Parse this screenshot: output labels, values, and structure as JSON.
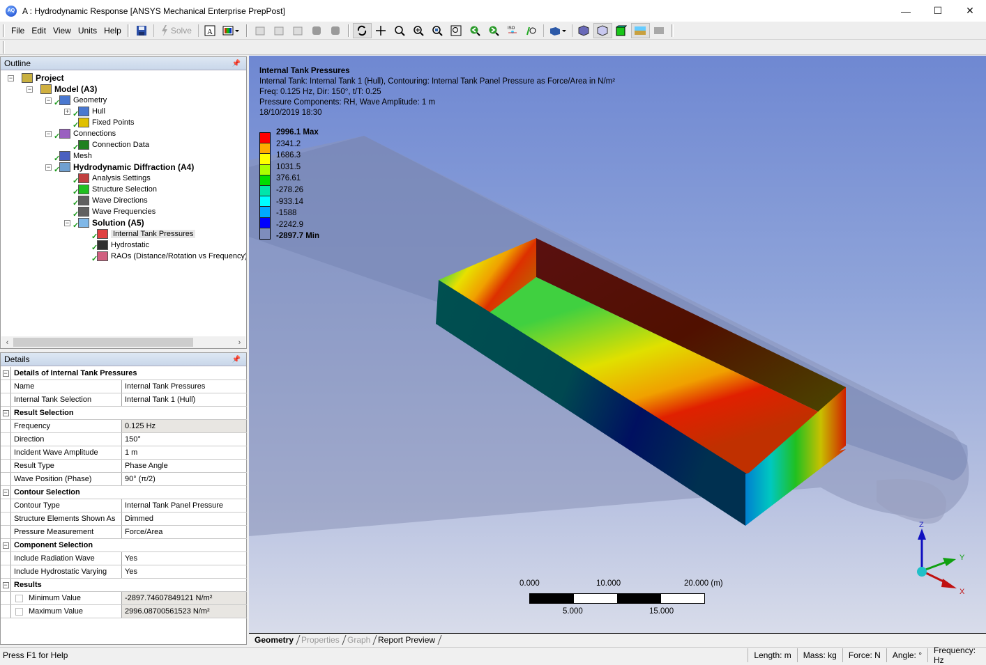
{
  "window": {
    "title": "A : Hydrodynamic Response [ANSYS Mechanical Enterprise PrepPost]",
    "app_icon_label": "AQ",
    "controls": {
      "minimize": "—",
      "maximize": "☐",
      "close": "✕"
    }
  },
  "menu": [
    "File",
    "Edit",
    "View",
    "Units",
    "Help"
  ],
  "toolbar": {
    "solve_label": "Solve",
    "icons": [
      "save-icon",
      "solve-icon",
      "annotation-icon",
      "display-style-icon",
      "select-point-icon",
      "select-face-icon",
      "select-body-icon",
      "select-face-filled-icon",
      "select-edge-icon",
      "rotate-icon",
      "pan-icon",
      "zoom-icon",
      "box-zoom-icon",
      "zoom-to-fit-icon",
      "zoom-region-icon",
      "previous-view-icon",
      "next-view-icon",
      "iso-view-icon",
      "look-at-icon",
      "view-box-icon",
      "wireframe-icon",
      "shaded-icon",
      "solid-green-icon",
      "water-surface-icon",
      "grey-box-icon"
    ]
  },
  "outline": {
    "title": "Outline",
    "nodes": [
      {
        "label": "Project",
        "bold": true,
        "level": 0,
        "icon": "project-icon",
        "check": false,
        "expander": "−"
      },
      {
        "label": "Model (A3)",
        "bold": true,
        "level": 1,
        "icon": "model-icon",
        "check": false,
        "expander": "−"
      },
      {
        "label": "Geometry",
        "bold": false,
        "level": 2,
        "icon": "geometry-icon",
        "check": true,
        "expander": "−"
      },
      {
        "label": "Hull",
        "bold": false,
        "level": 3,
        "icon": "body-icon",
        "check": true,
        "expander": "+"
      },
      {
        "label": "Fixed Points",
        "bold": false,
        "level": 3,
        "icon": "anchor-icon",
        "check": true,
        "expander": ""
      },
      {
        "label": "Connections",
        "bold": false,
        "level": 2,
        "icon": "connections-icon",
        "check": true,
        "expander": "−"
      },
      {
        "label": "Connection Data",
        "bold": false,
        "level": 3,
        "icon": "connection-data-icon",
        "check": true,
        "expander": ""
      },
      {
        "label": "Mesh",
        "bold": false,
        "level": 2,
        "icon": "mesh-icon",
        "check": true,
        "expander": ""
      },
      {
        "label": "Hydrodynamic Diffraction (A4)",
        "bold": true,
        "level": 2,
        "icon": "diffraction-icon",
        "check": true,
        "expander": "−"
      },
      {
        "label": "Analysis Settings",
        "bold": false,
        "level": 3,
        "icon": "analysis-settings-icon",
        "check": true,
        "expander": ""
      },
      {
        "label": "Structure Selection",
        "bold": false,
        "level": 3,
        "icon": "structure-selection-icon",
        "check": true,
        "expander": ""
      },
      {
        "label": "Wave Directions",
        "bold": false,
        "level": 3,
        "icon": "wave-directions-icon",
        "check": true,
        "expander": ""
      },
      {
        "label": "Wave Frequencies",
        "bold": false,
        "level": 3,
        "icon": "wave-frequencies-icon",
        "check": true,
        "expander": ""
      },
      {
        "label": "Solution (A5)",
        "bold": true,
        "level": 3,
        "icon": "solution-folder-icon",
        "check": true,
        "expander": "−"
      },
      {
        "label": "Internal Tank Pressures",
        "bold": false,
        "level": 4,
        "icon": "contour-result-icon",
        "check": true,
        "expander": "",
        "selected": true
      },
      {
        "label": "Hydrostatic",
        "bold": false,
        "level": 4,
        "icon": "table-icon",
        "check": true,
        "expander": ""
      },
      {
        "label": "RAOs (Distance/Rotation vs Frequency)",
        "bold": false,
        "level": 4,
        "icon": "graph-icon",
        "check": true,
        "expander": ""
      }
    ]
  },
  "details": {
    "title": "Details",
    "rows": [
      {
        "section": "Details of Internal Tank Pressures"
      },
      {
        "key": "Name",
        "value": "Internal Tank Pressures"
      },
      {
        "key": "Internal Tank Selection",
        "value": "Internal Tank 1 (Hull)"
      },
      {
        "section": "Result Selection"
      },
      {
        "key": "Frequency",
        "value": "0.125 Hz",
        "grey": true
      },
      {
        "key": "Direction",
        "value": "150°"
      },
      {
        "key": "Incident Wave Amplitude",
        "value": "1 m"
      },
      {
        "key": "Result Type",
        "value": "Phase Angle"
      },
      {
        "key": "Wave Position (Phase)",
        "value": "90° (π/2)"
      },
      {
        "section": "Contour Selection"
      },
      {
        "key": "Contour Type",
        "value": "Internal Tank Panel Pressure"
      },
      {
        "key": "Structure Elements Shown As",
        "value": "Dimmed"
      },
      {
        "key": "Pressure Measurement",
        "value": "Force/Area"
      },
      {
        "section": "Component Selection"
      },
      {
        "key": "Include Radiation Wave",
        "value": "Yes"
      },
      {
        "key": "Include Hydrostatic Varying",
        "value": "Yes"
      },
      {
        "section": "Results"
      },
      {
        "key": "Minimum Value",
        "value": "-2897.74607849121 N/m²",
        "grey": true,
        "checkbox": true
      },
      {
        "key": "Maximum Value",
        "value": "2996.08700561523 N/m²",
        "grey": true,
        "checkbox": true
      }
    ]
  },
  "viewport": {
    "info_title": "Internal Tank Pressures",
    "info_lines": [
      "Internal Tank: Internal Tank 1 (Hull), Contouring: Internal Tank Panel Pressure as Force/Area in N/m²",
      "Freq: 0.125 Hz, Dir: 150°, t/T: 0.25",
      "Pressure Components: RH, Wave Amplitude: 1 m",
      "18/10/2019 18:30"
    ],
    "legend": {
      "labels": [
        "2996.1 Max",
        "2341.2",
        "1686.3",
        "1031.5",
        "376.61",
        "-278.26",
        "-933.14",
        "-1588",
        "-2242.9",
        "-2897.7 Min"
      ],
      "colors": [
        "#ff0000",
        "#ffaa00",
        "#ffff00",
        "#aaff00",
        "#00dd00",
        "#00e6aa",
        "#00ffff",
        "#00aaff",
        "#0000ff"
      ]
    },
    "scale_bar": {
      "top_labels": [
        "0.000",
        "10.000",
        "20.000 (m)"
      ],
      "bottom_labels": [
        "5.000",
        "15.000"
      ]
    },
    "triad": {
      "x": "X",
      "y": "Y",
      "z": "Z"
    }
  },
  "tabs": [
    {
      "label": "Geometry",
      "state": "active"
    },
    {
      "label": "Properties",
      "state": "disabled"
    },
    {
      "label": "Graph",
      "state": "disabled"
    },
    {
      "label": "Report Preview",
      "state": "normal"
    }
  ],
  "status": {
    "help": "Press F1 for Help",
    "units": [
      "Length: m",
      "Mass: kg",
      "Force: N",
      "Angle: °",
      "Frequency: Hz"
    ]
  }
}
